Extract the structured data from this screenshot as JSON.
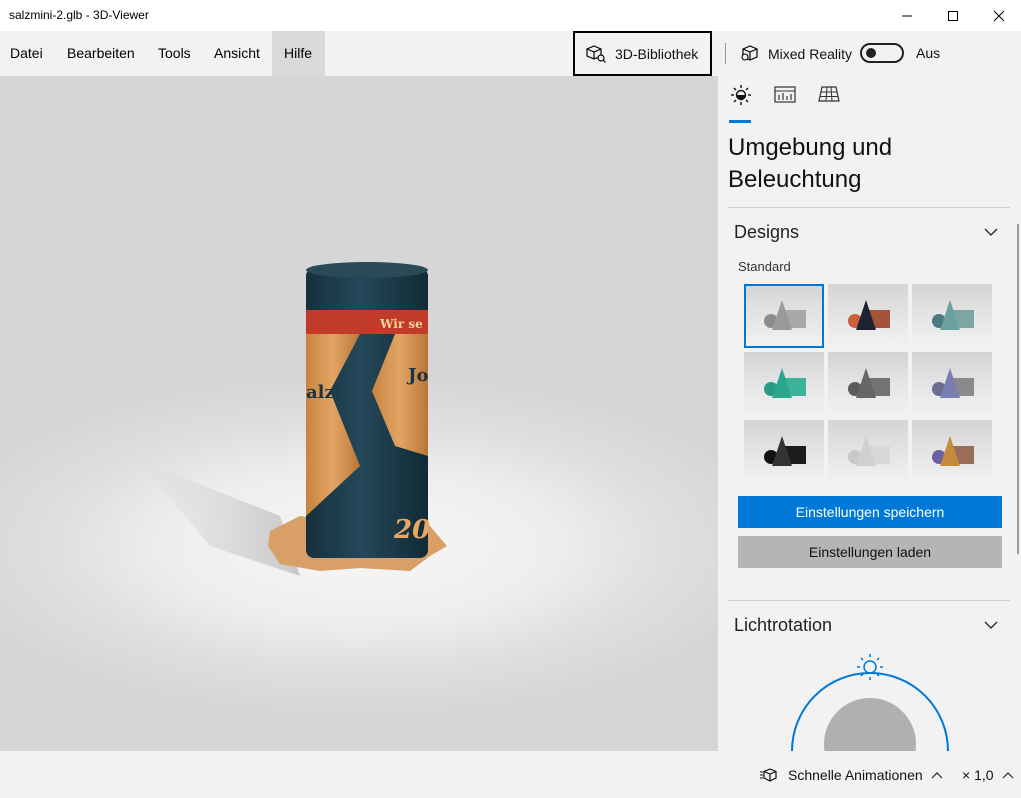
{
  "window": {
    "title": "salzmini-2.glb - 3D-Viewer"
  },
  "menu": {
    "items": [
      "Datei",
      "Bearbeiten",
      "Tools",
      "Ansicht",
      "Hilfe"
    ],
    "active": "Hilfe"
  },
  "toolbar": {
    "library_label": "3D-Bibliothek",
    "mixed_reality_label": "Mixed Reality",
    "mixed_reality_state": "Aus"
  },
  "model": {
    "label_text_1": "Wir se",
    "label_text_2": "Jo",
    "label_text_3": "alz",
    "label_text_4": "20",
    "colors": {
      "body": "#1f3c4a",
      "wrap": "#d99a5a",
      "band": "#c23a2a"
    }
  },
  "panel": {
    "tabs": [
      {
        "name": "environment-lighting-tab",
        "icon": "sun-icon"
      },
      {
        "name": "statistics-tab",
        "icon": "chart-icon"
      },
      {
        "name": "grid-tab",
        "icon": "grid-icon"
      }
    ],
    "title": "Umgebung und Beleuchtung",
    "designs": {
      "header": "Designs",
      "sublabel": "Standard",
      "tiles": [
        {
          "cone": "#9a9a9a",
          "sphere": "#8d8d8d",
          "box": "#a8a8a8",
          "selected": true
        },
        {
          "cone": "#1d2333",
          "sphere": "#c8623a",
          "box": "#a6533b",
          "selected": false
        },
        {
          "cone": "#6aa0a0",
          "sphere": "#4d7a80",
          "box": "#7aa7a2",
          "selected": false
        },
        {
          "cone": "#2aa68e",
          "sphere": "#2a9c84",
          "box": "#3bb39a",
          "selected": false
        },
        {
          "cone": "#666666",
          "sphere": "#5b5b5b",
          "box": "#737373",
          "selected": false
        },
        {
          "cone": "#7a7eb0",
          "sphere": "#6c6c8c",
          "box": "#8a8a8a",
          "selected": false
        },
        {
          "cone": "#333333",
          "sphere": "#111111",
          "box": "#1c1c1c",
          "selected": false
        },
        {
          "cone": "#d0d0d0",
          "sphere": "#c9c9c9",
          "box": "#d8d8d8",
          "selected": false
        },
        {
          "cone": "#c58b3a",
          "sphere": "#6e5fa0",
          "box": "#9a6c5a",
          "selected": false
        }
      ],
      "save_button": "Einstellungen speichern",
      "load_button": "Einstellungen laden"
    },
    "light_rotation": {
      "header": "Lichtrotation"
    }
  },
  "statusbar": {
    "animations_label": "Schnelle Animationen",
    "speed": "× 1,0"
  },
  "colors": {
    "accent": "#0078d7"
  }
}
